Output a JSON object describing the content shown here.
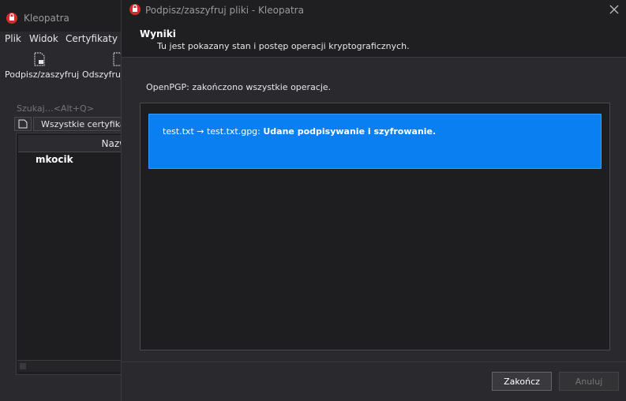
{
  "main_window": {
    "title": "Kleopatra",
    "menu": [
      "Plik",
      "Widok",
      "Certyfikaty"
    ],
    "toolbar": {
      "sign_encrypt": "Podpisz/zaszyfruj",
      "decrypt": "Odszyfruj/"
    },
    "search": {
      "placeholder": "Szukaj…<Alt+Q>"
    },
    "filter": {
      "selected": "Wszystkie certyfikaty"
    },
    "list": {
      "column_header": "Nazw",
      "rows": [
        "mkocik"
      ]
    }
  },
  "dialog": {
    "title": "Podpisz/zaszyfruj pliki - Kleopatra",
    "header": {
      "title": "Wyniki",
      "subtitle": "Tu jest pokazany stan i postęp operacji kryptograficznych."
    },
    "status": "OpenPGP: zakończono wszystkie operacje.",
    "result": {
      "files": "test.txt → test.txt.gpg:",
      "message": "Udane podpisywanie i szyfrowanie."
    },
    "buttons": {
      "finish": "Zakończ",
      "cancel": "Anuluj"
    }
  },
  "colors": {
    "accent": "#0a7ff2",
    "background": "#2a2a2e",
    "titlebar": "#1f1f22",
    "logo_red": "#d62b2b"
  },
  "icons": [
    "kleopatra-logo-icon",
    "sign-encrypt-icon",
    "decrypt-icon",
    "certificate-icon",
    "close-icon",
    "scroll-left-icon"
  ]
}
